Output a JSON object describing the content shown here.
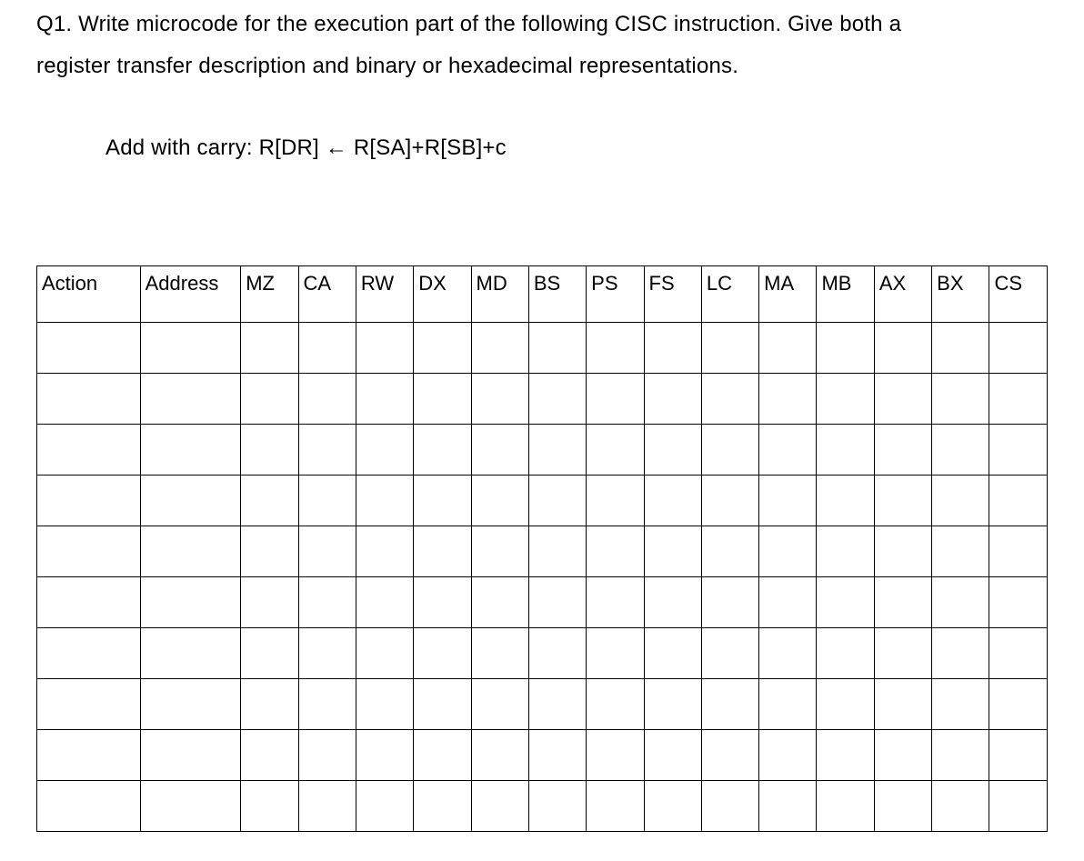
{
  "question": {
    "prefix": "Q1.",
    "text_line1": "Q1. Write microcode for the execution part of the following CISC instruction. Give both a",
    "text_line2": "register transfer description and binary or hexadecimal representations."
  },
  "instruction": "Add with carry: R[DR] ← R[SA]+R[SB]+c",
  "table": {
    "headers": [
      "Action",
      "Address",
      "MZ",
      "CA",
      "RW",
      "DX",
      "MD",
      "BS",
      "PS",
      "FS",
      "LC",
      "MA",
      "MB",
      "AX",
      "BX",
      "CS"
    ],
    "empty_rows": 10
  }
}
